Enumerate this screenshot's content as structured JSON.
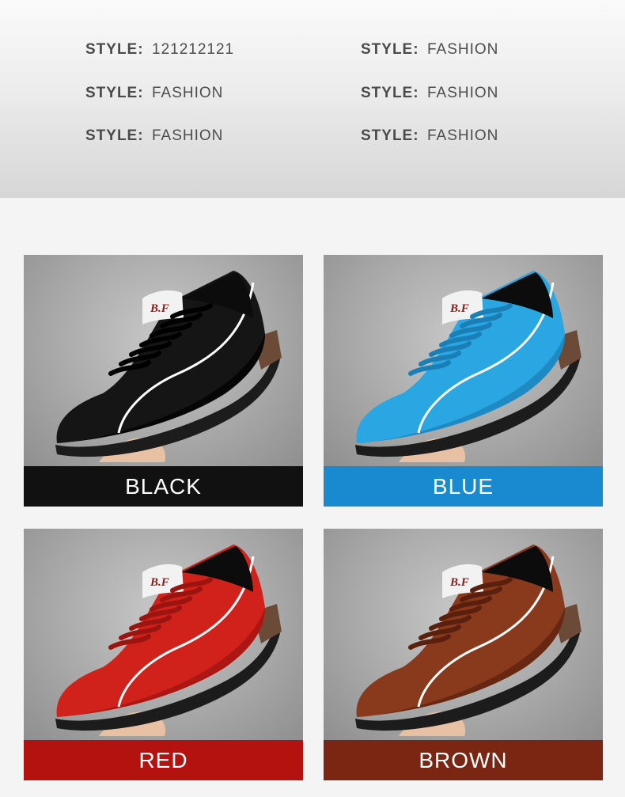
{
  "specs": [
    {
      "key": "STYLE:",
      "value": "121212121"
    },
    {
      "key": "STYLE:",
      "value": "FASHION"
    },
    {
      "key": "STYLE:",
      "value": "FASHION"
    },
    {
      "key": "STYLE:",
      "value": "FASHION"
    },
    {
      "key": "STYLE:",
      "value": "FASHION"
    },
    {
      "key": "STYLE:",
      "value": "FASHION"
    }
  ],
  "products": [
    {
      "label": "BLACK",
      "bar_color": "#111111",
      "shoe_color": "#151515",
      "shoe_shade": "#000000",
      "tongue_logo": "B.F"
    },
    {
      "label": "BLUE",
      "bar_color": "#1a8ad0",
      "shoe_color": "#2aa6e2",
      "shoe_shade": "#1a7fb6",
      "tongue_logo": "B.F"
    },
    {
      "label": "RED",
      "bar_color": "#b3120e",
      "shoe_color": "#d0211b",
      "shoe_shade": "#9c1410",
      "tongue_logo": "B.F"
    },
    {
      "label": "BROWN",
      "bar_color": "#7a2612",
      "shoe_color": "#8a3a1c",
      "shoe_shade": "#5a200d",
      "tongue_logo": "B.F"
    }
  ]
}
